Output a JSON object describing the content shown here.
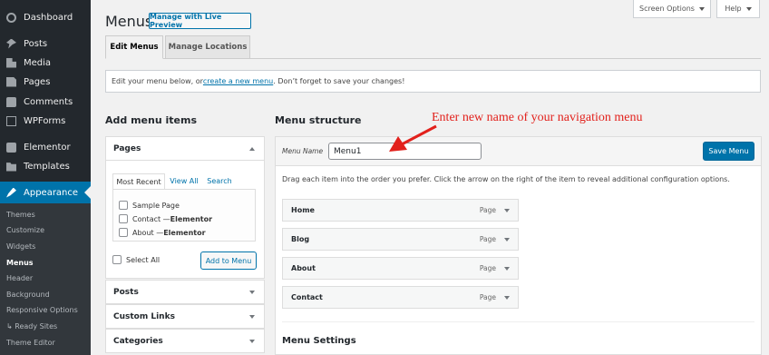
{
  "sidebar": {
    "items": [
      {
        "label": "Dashboard",
        "icon": "dashboard-icon"
      },
      {
        "label": "Posts",
        "icon": "pin-icon"
      },
      {
        "label": "Media",
        "icon": "media-icon"
      },
      {
        "label": "Pages",
        "icon": "page-icon"
      },
      {
        "label": "Comments",
        "icon": "comment-icon"
      },
      {
        "label": "WPForms",
        "icon": "form-icon"
      },
      {
        "label": "Elementor",
        "icon": "elementor-icon"
      },
      {
        "label": "Templates",
        "icon": "folder-icon"
      }
    ],
    "active": {
      "label": "Appearance",
      "icon": "brush-icon"
    },
    "submenu": [
      "Themes",
      "Customize",
      "Widgets",
      "Menus",
      "Header",
      "Background",
      "Responsive Options",
      "↳ Ready Sites",
      "Theme Editor"
    ],
    "accent_color": "#0073aa"
  },
  "top": {
    "screen_options": "Screen Options",
    "help": "Help"
  },
  "header": {
    "title": "Menus",
    "live_preview": "Manage with Live Preview"
  },
  "tabs": [
    "Edit Menus",
    "Manage Locations"
  ],
  "notice": {
    "before": "Edit your menu below, or ",
    "link": "create a new menu",
    "after": ". Don’t forget to save your changes!"
  },
  "left": {
    "heading": "Add menu items",
    "pages": {
      "title": "Pages",
      "tabs": [
        "Most Recent",
        "View All",
        "Search"
      ],
      "items": [
        {
          "name": "Sample Page",
          "suffix": ""
        },
        {
          "name": "Contact — ",
          "suffix": "Elementor"
        },
        {
          "name": "About — ",
          "suffix": "Elementor"
        }
      ],
      "select_all": "Select All",
      "add_button": "Add to Menu"
    },
    "sections": [
      "Posts",
      "Custom Links",
      "Categories"
    ]
  },
  "right": {
    "heading": "Menu structure",
    "menu_name_label": "Menu Name",
    "menu_name_value": "Menu1",
    "save_button": "Save Menu",
    "hint": "Drag each item into the order you prefer. Click the arrow on the right of the item to reveal additional configuration options.",
    "items": [
      {
        "label": "Home",
        "type": "Page"
      },
      {
        "label": "Blog",
        "type": "Page"
      },
      {
        "label": "About",
        "type": "Page"
      },
      {
        "label": "Contact",
        "type": "Page"
      }
    ],
    "settings_heading": "Menu Settings"
  },
  "annotation": {
    "text": "Enter new name of your navigation menu",
    "color": "#e2211c"
  }
}
